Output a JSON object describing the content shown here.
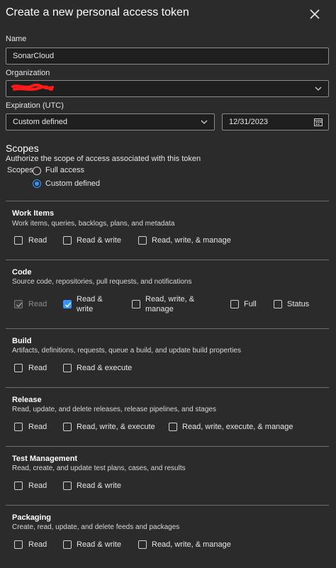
{
  "dialog": {
    "title": "Create a new personal access token"
  },
  "name_field": {
    "label": "Name",
    "value": "SonarCloud"
  },
  "organization_field": {
    "label": "Organization",
    "value": ""
  },
  "expiration": {
    "label": "Expiration (UTC)",
    "preset": "Custom defined",
    "date": "12/31/2023"
  },
  "scopes": {
    "heading": "Scopes",
    "description": "Authorize the scope of access associated with this token",
    "word": "Scopes",
    "options": [
      {
        "label": "Full access",
        "selected": false
      },
      {
        "label": "Custom defined",
        "selected": true
      }
    ]
  },
  "sections": {
    "work_items": {
      "title": "Work Items",
      "desc": "Work items, queries, backlogs, plans, and metadata",
      "opts": [
        "Read",
        "Read & write",
        "Read, write, & manage"
      ]
    },
    "code": {
      "title": "Code",
      "desc": "Source code, repositories, pull requests, and notifications",
      "opts": [
        "Read",
        "Read &",
        "write",
        "Read, write, &",
        "manage",
        "Full",
        "Status"
      ],
      "checked": [
        "Read (disabled)",
        "Read & write"
      ]
    },
    "build": {
      "title": "Build",
      "desc": "Artifacts, definitions, requests, queue a build, and update build properties",
      "opts": [
        "Read",
        "Read & execute"
      ]
    },
    "release": {
      "title": "Release",
      "desc": "Read, update, and delete releases, release pipelines, and stages",
      "opts": [
        "Read",
        "Read, write, & execute",
        "Read, write, execute, & manage"
      ]
    },
    "test_management": {
      "title": "Test Management",
      "desc": "Read, create, and update test plans, cases, and results",
      "opts": [
        "Read",
        "Read & write"
      ]
    },
    "packaging": {
      "title": "Packaging",
      "desc": "Create, read, update, and delete feeds and packages",
      "opts": [
        "Read",
        "Read & write",
        "Read, write, & manage"
      ]
    }
  },
  "colors": {
    "accent": "#3794ff",
    "background": "#2b2b2b",
    "redaction": "#ff1a1a"
  }
}
